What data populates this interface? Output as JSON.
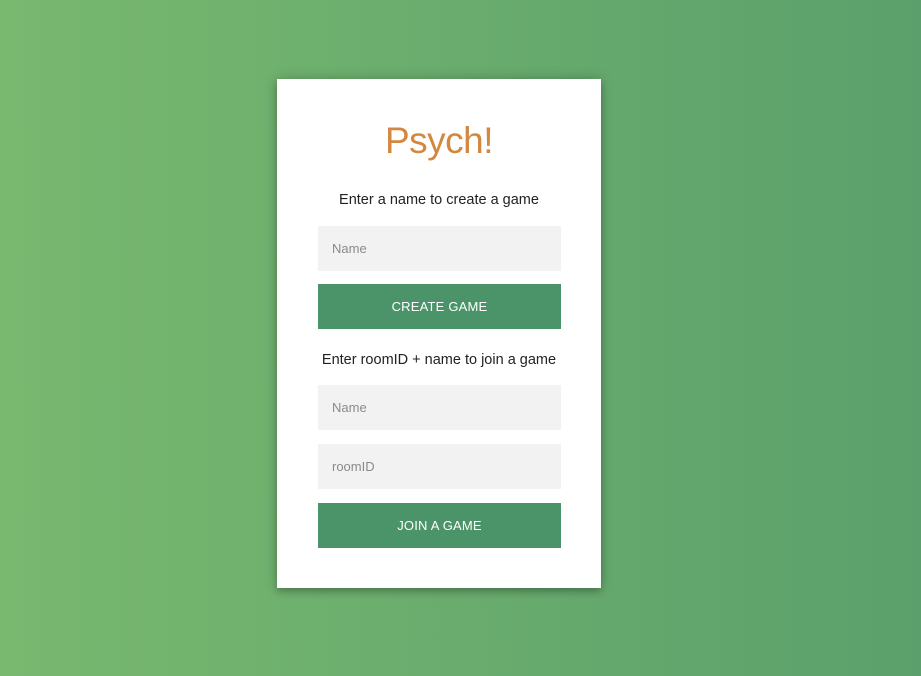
{
  "app": {
    "title": "Psych!"
  },
  "create": {
    "instruction": "Enter a name to create a game",
    "name_placeholder": "Name",
    "name_value": "",
    "button_label": "CREATE GAME"
  },
  "join": {
    "instruction": "Enter roomID + name to join a game",
    "name_placeholder": "Name",
    "name_value": "",
    "room_placeholder": "roomID",
    "room_value": "",
    "button_label": "JOIN A GAME"
  },
  "colors": {
    "title": "#d4873f",
    "button": "#4b946a",
    "background_start": "#78b86f",
    "background_end": "#5ba06c",
    "field_bg": "#f2f2f2"
  }
}
